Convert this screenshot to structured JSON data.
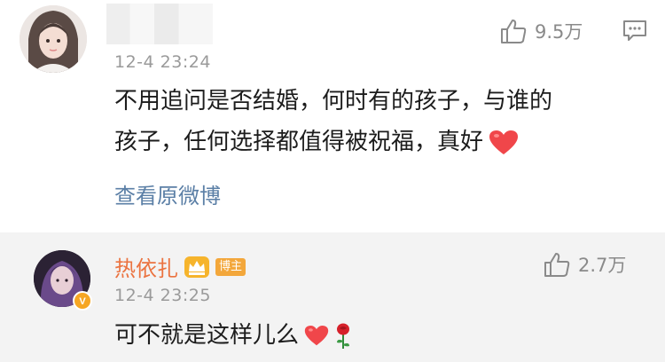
{
  "comments": [
    {
      "timestamp": "12-4 23:24",
      "likes": "9.5万",
      "text_line1": "不用追问是否结婚，何时有的孩子，与谁的",
      "text_line2": "孩子，任何选择都值得被祝福，真好",
      "view_original": "查看原微博",
      "emoji": "red-heart-icon"
    },
    {
      "username": "热依扎",
      "badge": "博主",
      "timestamp": "12-4 23:25",
      "likes": "2.7万",
      "text": "可不就是这样儿么",
      "emoji": [
        "red-heart-icon",
        "rose-icon"
      ]
    }
  ],
  "colors": {
    "username": "#eb7340",
    "link": "#5b7fa6",
    "meta": "#9a9a9a",
    "badge": "#f3a73b",
    "heart": "#f0464a"
  }
}
